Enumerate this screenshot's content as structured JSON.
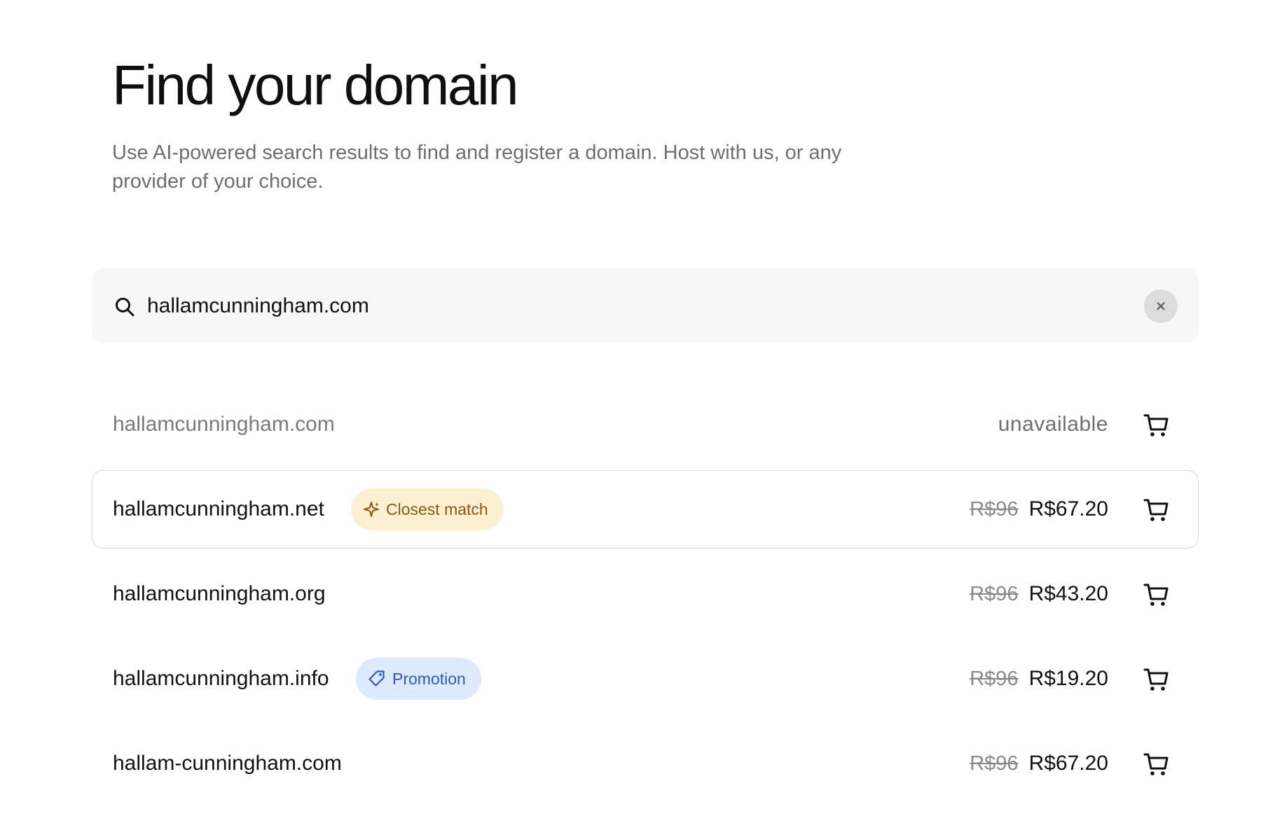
{
  "header": {
    "title": "Find your domain",
    "subtitle": "Use AI-powered search results to find and register a domain. Host with us, or any provider of your choice."
  },
  "search": {
    "value": "hallamcunningham.com",
    "icon": "search-icon",
    "clear_icon": "close-icon"
  },
  "results": [
    {
      "domain": "hallamcunningham.com",
      "status": "unavailable",
      "badge": null,
      "old_price": "",
      "price": ""
    },
    {
      "domain": "hallamcunningham.net",
      "status": "",
      "badge": {
        "label": "Closest match",
        "icon": "sparkle-icon"
      },
      "old_price": "R$96",
      "price": "R$67.20"
    },
    {
      "domain": "hallamcunningham.org",
      "status": "",
      "badge": null,
      "old_price": "R$96",
      "price": "R$43.20"
    },
    {
      "domain": "hallamcunningham.info",
      "status": "",
      "badge": {
        "label": "Promotion",
        "icon": "tag-icon"
      },
      "old_price": "R$96",
      "price": "R$19.20"
    },
    {
      "domain": "hallam-cunningham.com",
      "status": "",
      "badge": null,
      "old_price": "R$96",
      "price": "R$67.20"
    }
  ],
  "colors": {
    "closest_match_bg": "#fbf1d2",
    "closest_match_text": "#8a5a12",
    "promotion_bg": "#dde9fc",
    "promotion_text": "#2a5db5",
    "search_bg": "#f7f7f7"
  }
}
